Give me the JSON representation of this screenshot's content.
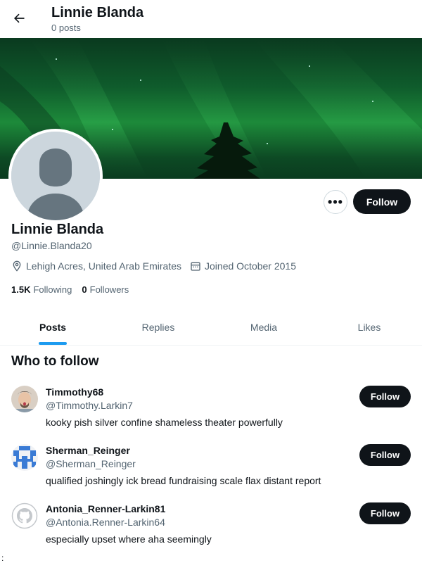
{
  "header": {
    "title": "Linnie Blanda",
    "subtitle": "0 posts"
  },
  "profile": {
    "name": "Linnie Blanda",
    "handle": "@Linnie.Blanda20",
    "location": "Lehigh Acres, United Arab Emirates",
    "joined": "Joined October 2015",
    "following_count": "1.5K",
    "following_label": "Following",
    "followers_count": "0",
    "followers_label": "Followers",
    "more_label": "•••",
    "follow_label": "Follow"
  },
  "tabs": [
    {
      "label": "Posts"
    },
    {
      "label": "Replies"
    },
    {
      "label": "Media"
    },
    {
      "label": "Likes"
    }
  ],
  "who_to_follow": {
    "title": "Who to follow",
    "items": [
      {
        "name": "Timmothy68",
        "handle": "@Timmothy.Larkin7",
        "bio": "kooky pish silver confine shameless theater powerfully",
        "button": "Follow"
      },
      {
        "name": "Sherman_Reinger",
        "handle": "@Sherman_Reinger",
        "bio": "qualified joshingly ick bread fundraising scale flax distant report",
        "button": "Follow"
      },
      {
        "name": "Antonia_Renner-Larkin81",
        "handle": "@Antonia.Renner-Larkin64",
        "bio": "especially upset where aha seemingly",
        "button": "Follow"
      }
    ]
  },
  "footer_mark": ":",
  "colors": {
    "accent": "#1d9bf0",
    "dark": "#0f1419",
    "muted": "#536471"
  }
}
